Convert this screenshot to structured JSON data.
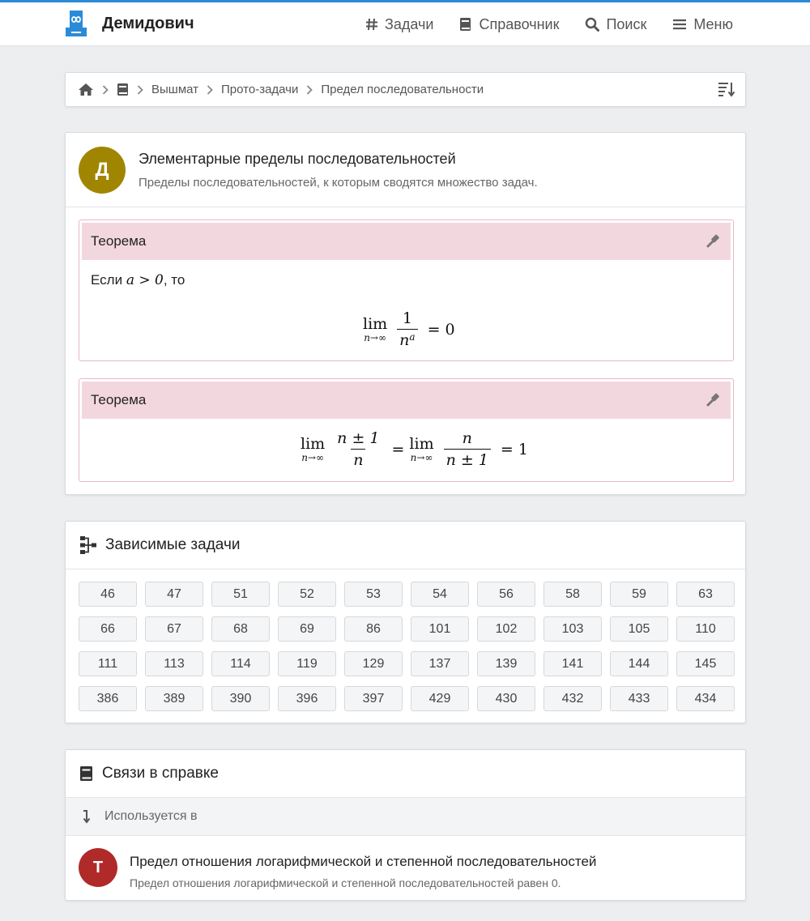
{
  "navbar": {
    "brand": "Демидович",
    "items": [
      {
        "label": "Задачи",
        "icon": "hash-icon"
      },
      {
        "label": "Справочник",
        "icon": "book-icon"
      },
      {
        "label": "Поиск",
        "icon": "search-icon"
      },
      {
        "label": "Меню",
        "icon": "menu-icon"
      }
    ]
  },
  "breadcrumb": {
    "items": [
      "Вышмат",
      "Прото-задачи",
      "Предел последовательности"
    ]
  },
  "topic": {
    "avatar_letter": "Д",
    "avatar_color": "#a08600",
    "title": "Элементарные пределы последовательностей",
    "subtitle": "Пределы последовательностей, к которым сводятся множество задач."
  },
  "theorems": [
    {
      "label": "Теорема",
      "text_before": "Если",
      "condition": "a > 0",
      "text_after": ", то",
      "formula": {
        "lim_sub": "n→∞",
        "numerator": "1",
        "denominator": "n",
        "exponent": "a",
        "rhs": "0"
      }
    },
    {
      "label": "Теорема",
      "formula": {
        "lim_sub": "n→∞",
        "left_num": "n ± 1",
        "left_den": "n",
        "right_num": "n",
        "right_den": "n ± 1",
        "rhs": "1"
      }
    }
  ],
  "dependent": {
    "title": "Зависимые задачи",
    "tasks": [
      "46",
      "47",
      "51",
      "52",
      "53",
      "54",
      "56",
      "58",
      "59",
      "63",
      "66",
      "67",
      "68",
      "69",
      "86",
      "101",
      "102",
      "103",
      "105",
      "110",
      "111",
      "113",
      "114",
      "119",
      "129",
      "137",
      "139",
      "141",
      "144",
      "145",
      "386",
      "389",
      "390",
      "396",
      "397",
      "429",
      "430",
      "432",
      "433",
      "434"
    ]
  },
  "links": {
    "title": "Связи в справке",
    "used_in_label": "Используется в",
    "items": [
      {
        "avatar_letter": "Т",
        "avatar_color": "#b02a2a",
        "title": "Предел отношения логарифмической и степенной последовательностей",
        "subtitle": "Предел отношения логарифмической и степенной последовательностей равен 0."
      }
    ]
  },
  "colors": {
    "accent": "#2a8bd8",
    "theorem_header_bg": "#f3d7df",
    "theorem_border": "#e8b8c6"
  }
}
